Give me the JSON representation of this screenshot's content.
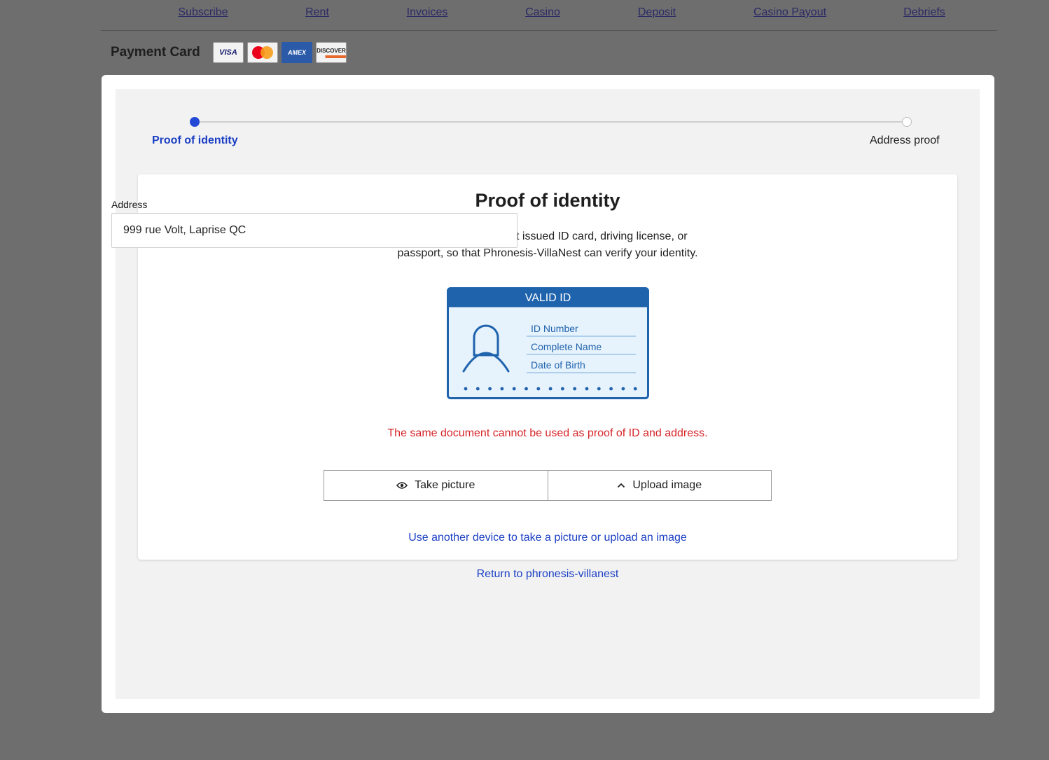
{
  "nav": {
    "items": [
      {
        "label": "Subscribe"
      },
      {
        "label": "Rent"
      },
      {
        "label": "Invoices"
      },
      {
        "label": "Casino"
      },
      {
        "label": "Deposit"
      },
      {
        "label": "Casino Payout"
      },
      {
        "label": "Debriefs"
      }
    ]
  },
  "payment": {
    "title": "Payment Card",
    "cards": {
      "visa": "VISA",
      "amex": "AMEX",
      "discover": "DISCOVER"
    }
  },
  "stepper": {
    "steps": [
      {
        "label": "Proof of identity",
        "state": "active"
      },
      {
        "label": "Address proof",
        "state": "inactive"
      }
    ]
  },
  "panel": {
    "title": "Proof of identity",
    "description_line1": "nment issued ID card, driving license, or",
    "description_line2": "passport, so that Phronesis-VillaNest can verify your identity.",
    "id_card": {
      "header": "VALID ID",
      "fields": [
        "ID Number",
        "Complete Name",
        "Date of Birth"
      ]
    },
    "error": "The same document cannot be used as proof of ID and address.",
    "take_picture": "Take picture",
    "upload_image": "Upload image",
    "alt_device_link": "Use another device to take a picture or upload an image"
  },
  "return_link": "Return to phronesis-villanest",
  "address": {
    "label": "Address",
    "value": "999 rue Volt, Laprise QC"
  },
  "colors": {
    "accent": "#1b3fc4",
    "error": "#d7262b",
    "id_card_blue": "#1f63ad",
    "overlay": "#6e6e6e"
  }
}
